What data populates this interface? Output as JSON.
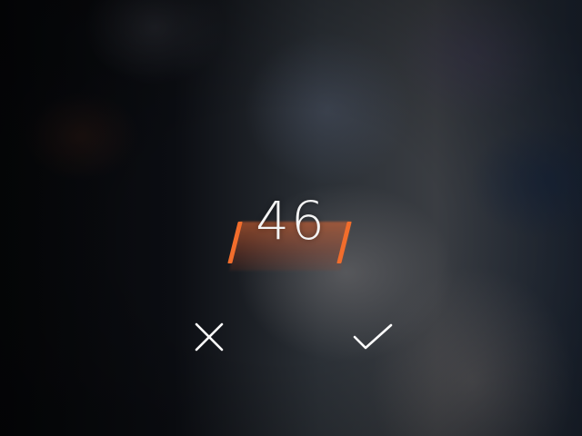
{
  "value_picker": {
    "value": "46",
    "accent_color": "#f26d2c"
  },
  "actions": {
    "cancel_icon": "close-icon",
    "confirm_icon": "checkmark-icon"
  }
}
